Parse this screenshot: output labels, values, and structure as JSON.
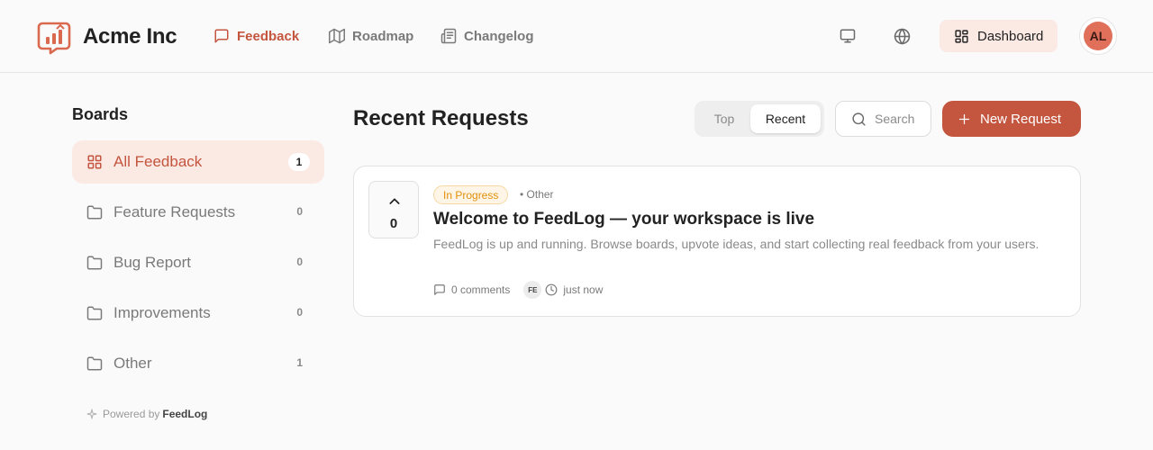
{
  "header": {
    "brand": "Acme Inc",
    "nav": [
      {
        "label": "Feedback",
        "icon": "message-square-icon",
        "active": true
      },
      {
        "label": "Roadmap",
        "icon": "map-icon",
        "active": false
      },
      {
        "label": "Changelog",
        "icon": "newspaper-icon",
        "active": false
      }
    ],
    "dashboard_label": "Dashboard",
    "avatar_initials": "AL"
  },
  "sidebar": {
    "title": "Boards",
    "items": [
      {
        "label": "All Feedback",
        "count": "1",
        "icon": "grid-icon",
        "active": true
      },
      {
        "label": "Feature Requests",
        "count": "0",
        "icon": "folder-icon"
      },
      {
        "label": "Bug Report",
        "count": "0",
        "icon": "folder-icon"
      },
      {
        "label": "Improvements",
        "count": "0",
        "icon": "folder-icon"
      },
      {
        "label": "Other",
        "count": "1",
        "icon": "folder-icon"
      }
    ],
    "powered_prefix": "Powered by",
    "powered_brand": "FeedLog"
  },
  "main": {
    "title": "Recent Requests",
    "sort_tabs": [
      {
        "label": "Top",
        "active": false
      },
      {
        "label": "Recent",
        "active": true
      }
    ],
    "search_placeholder": "Search",
    "new_request_label": "New Request",
    "posts": [
      {
        "votes": "0",
        "status": "In Progress",
        "category": "• Other",
        "title": "Welcome to FeedLog — your workspace is live",
        "description": "FeedLog is up and running. Browse boards, upvote ideas, and start collecting real feedback from your users.",
        "comments": "0 comments",
        "author_initials": "FE",
        "time": "just now"
      }
    ]
  },
  "colors": {
    "accent": "#c4553e",
    "accent_light": "#fbe9e4",
    "status_in_progress": "#e0900a"
  }
}
